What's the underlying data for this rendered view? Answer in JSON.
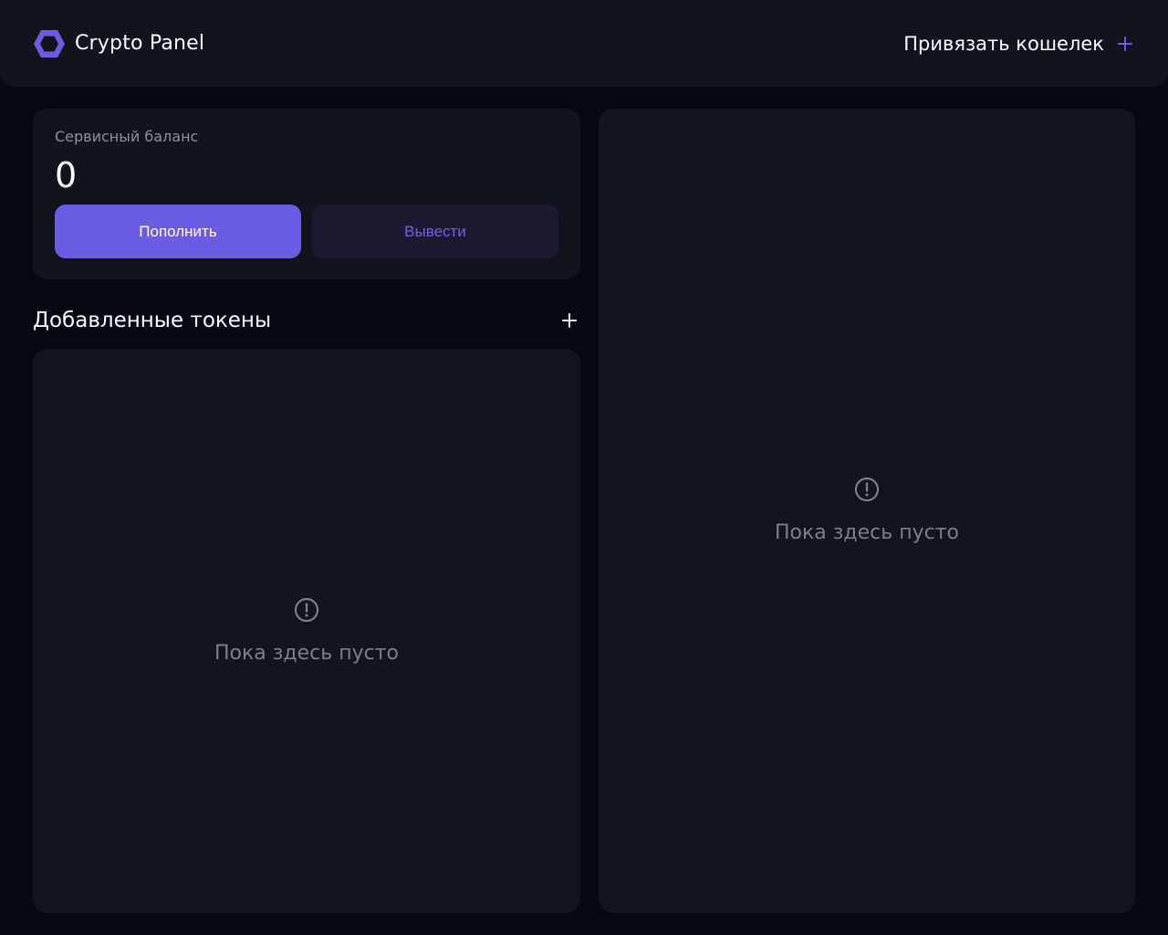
{
  "header": {
    "app_title": "Crypto Panel",
    "logo_icon": "hexagon-logo-icon",
    "connect_wallet_label": "Привязать кошелек",
    "connect_wallet_icon": "plus-icon"
  },
  "balance": {
    "label": "Сервисный баланс",
    "value": "0",
    "deposit_label": "Пополнить",
    "withdraw_label": "Вывести"
  },
  "tokens": {
    "title": "Добавленные токены",
    "add_icon": "plus-icon",
    "empty_icon": "alert-circle-icon",
    "empty_text": "Пока здесь пусто"
  },
  "right_panel": {
    "empty_icon": "alert-circle-icon",
    "empty_text": "Пока здесь пусто"
  },
  "colors": {
    "background": "#060911",
    "surface": "#0f141d",
    "accent": "#6b5de3",
    "accent_text": "#6e62e4",
    "secondary_button": "#1b1a31",
    "muted_text": "#7a8088"
  }
}
